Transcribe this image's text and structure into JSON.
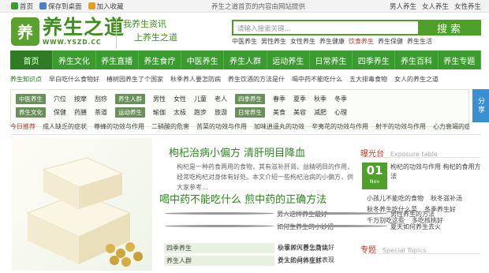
{
  "topbar": {
    "home": "首页",
    "save_desktop": "保存到桌面",
    "favorite": "加入收藏",
    "notice": "养生之道首页的内容由网站提供",
    "right_links": [
      "男人养生",
      "女人养生",
      "女性养生"
    ]
  },
  "header": {
    "logo_mark": "养",
    "logo_text": "养生之道",
    "logo_url": "WWW.YSZD.CC",
    "slogan_lines": [
      "我养生资讯",
      "上养生之道"
    ],
    "search_placeholder": "请输入搜索关键...",
    "search_button": "搜索",
    "hot_links": [
      "中医养生",
      "男性养生",
      "女性养生",
      "养生健康",
      "饮食养生",
      "养生保健",
      "养生生活"
    ]
  },
  "nav": [
    "首页",
    "养生文化",
    "养生直播",
    "养生食疗",
    "中医养生",
    "养生人群",
    "运动养生",
    "日常养生",
    "四季养生",
    "养生百科",
    "养生专题"
  ],
  "sub1": [
    "养生知识点",
    "早白吃什么食物好",
    "椿树园养生了个国家",
    "秋季养人要怎防病",
    "养生饮酒的方法是什",
    "喝中药不能吃什么",
    "五大排毒食物",
    "女人的养生之道"
  ],
  "grid": {
    "rows": [
      {
        "tag": "中医养生",
        "items": [
          "穴位",
          "按摩",
          "刮痧"
        ],
        "tag2": "养生人群",
        "items2": [
          "男性",
          "女性",
          "儿童",
          "老人"
        ],
        "tag3": "四季养生",
        "items3": [
          "春季",
          "夏季",
          "秋季",
          "冬季"
        ]
      },
      {
        "tag": "养生文化",
        "items": [
          "保健",
          "药膳",
          "茶道"
        ],
        "tag2": "运动养生",
        "items2": [
          "瑜伽",
          "太极",
          "跑步",
          "旅游"
        ],
        "tag3": "日常养生",
        "items3": [
          "美食",
          "美容",
          "减肥",
          "心理"
        ]
      }
    ]
  },
  "share": "分享",
  "ticker": {
    "label": "今日推荐",
    "items": [
      "成人缺乏的症状",
      "尊蜂的功效与作用",
      "二硝酸的危害",
      "苦菜的功效与作用",
      "加味逍遥丸的功效",
      "辛夷花的功效与作用",
      "射干的功效与作用",
      "心力衰竭的症状"
    ]
  },
  "article": {
    "title": "枸杞治病小偏方 清肝明目降血",
    "desc": "枸杞是一种药食两用的食物，其有滋补肝肾、益精明目的作用，经常吃枸杞对身体有好处。本文介绍一些枸杞治病的小偏方，供大家参考...",
    "title2": "喝中药不能吃什么 煎中药的正确方法",
    "list": [
      {
        "l": "男人这样养生最好",
        "r": "男性养生的方法"
      },
      {
        "l": "如何生养生的小妙招",
        "r": "夏天如何养生去火"
      }
    ],
    "tag_rows": [
      {
        "tag": "四季养生",
        "l": "秋季养人要怎防病",
        "r": "小雪如何养生身体好"
      },
      {
        "tag": "养生人群",
        "l": "女人如何养生好",
        "r": "养生的具体症状表现"
      }
    ]
  },
  "side": {
    "title": "曝光台",
    "subtitle": "Exposure table",
    "date_num": "01",
    "date_label": "Nov",
    "text": "枸杞的功效与作用 枸杞的食用方法",
    "list": [
      [
        "小孩儿不能吃的食物",
        "秋冬滋补汤"
      ],
      [
        "秋冬养生吃什么菜",
        "冬季养生好"
      ],
      [
        "千万别吃这些",
        "多吃核桃好"
      ]
    ],
    "title2": "专题",
    "subtitle2": "Special Topics"
  },
  "colors": {
    "brand": "#3a9b2e",
    "accent": "#c0392b"
  }
}
